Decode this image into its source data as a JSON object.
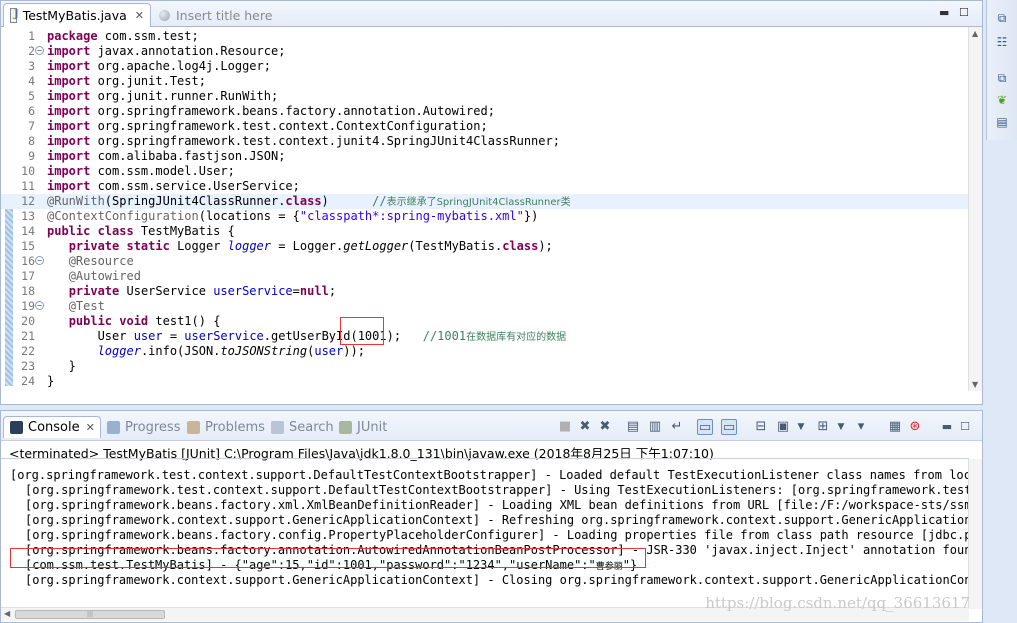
{
  "editor": {
    "tabs": [
      {
        "label": "TestMyBatis.java"
      },
      {
        "label": "Insert title here"
      }
    ],
    "lines": [
      {
        "n": "1",
        "html": "<span class=\"kw\">package</span> com.ssm.test;"
      },
      {
        "n": "2",
        "fold": true,
        "html": "<span class=\"kw\">import</span> javax.annotation.Resource;"
      },
      {
        "n": "3",
        "html": "<span class=\"kw\">import</span> org.apache.log4j.Logger;"
      },
      {
        "n": "4",
        "html": "<span class=\"kw\">import</span> org.junit.Test;"
      },
      {
        "n": "5",
        "html": "<span class=\"kw\">import</span> org.junit.runner.RunWith;"
      },
      {
        "n": "6",
        "html": "<span class=\"kw\">import</span> org.springframework.beans.factory.annotation.Autowired;"
      },
      {
        "n": "7",
        "html": "<span class=\"kw\">import</span> org.springframework.test.context.ContextConfiguration;"
      },
      {
        "n": "8",
        "html": "<span class=\"kw\">import</span> org.springframework.test.context.junit4.SpringJUnit4ClassRunner;"
      },
      {
        "n": "9",
        "html": "<span class=\"kw\">import</span> com.alibaba.fastjson.JSON;"
      },
      {
        "n": "10",
        "html": "<span class=\"kw\">import</span> com.ssm.model.User;"
      },
      {
        "n": "11",
        "html": "<span class=\"kw\">import</span> com.ssm.service.UserService;"
      },
      {
        "n": "12",
        "hl": true,
        "html": "<span class=\"an\">@RunWith</span>(SpringJUnit4ClassRunner.<span class=\"kw\">class</span>)      <span class=\"cm\">//</span><span class=\"cmc\">表示继承了SpringJUnit4ClassRunner类</span>"
      },
      {
        "n": "13",
        "html": "<span class=\"an\">@ContextConfiguration</span>(locations = {<span class=\"st\">\"classpath*:spring-mybatis.xml\"</span>})"
      },
      {
        "n": "14",
        "html": "<span class=\"kw\">public class</span> TestMyBatis {"
      },
      {
        "n": "15",
        "html": "   <span class=\"kw\">private static</span> Logger <span class=\"fi\">logger</span> = Logger.<span class=\"sm\">getLogger</span>(TestMyBatis.<span class=\"kw\">class</span>);"
      },
      {
        "n": "16",
        "fold": true,
        "html": "   <span class=\"an\">@Resource</span>"
      },
      {
        "n": "17",
        "html": "   <span class=\"an\">@Autowired</span>"
      },
      {
        "n": "18",
        "html": "   <span class=\"kw\">private</span> UserService <span class=\"fd\">userService</span>=<span class=\"kw\">null</span>;"
      },
      {
        "n": "19",
        "fold": true,
        "html": "   <span class=\"an\">@Test</span>"
      },
      {
        "n": "20",
        "html": "   <span class=\"kw\">public void</span> test1() {"
      },
      {
        "n": "21",
        "html": "       User <span class=\"fd\">user</span> = <span class=\"fd\">userService</span>.getUserById(1001);   <span class=\"cm\">//1001</span><span class=\"cmc\">在数据库有对应的数据</span>"
      },
      {
        "n": "22",
        "html": "       <span class=\"fi\">logger</span>.info(JSON.<span class=\"sm\">toJSONString</span>(<span class=\"fd\">user</span>));"
      },
      {
        "n": "23",
        "html": "   }"
      },
      {
        "n": "24",
        "html": "}"
      }
    ]
  },
  "console": {
    "tabs": [
      {
        "label": "Console"
      },
      {
        "label": "Progress"
      },
      {
        "label": "Problems"
      },
      {
        "label": "Search"
      },
      {
        "label": "JUnit"
      }
    ],
    "terminated": "<terminated> TestMyBatis [JUnit] C:\\Program Files\\Java\\jdk1.8.0_131\\bin\\javaw.exe (2018年8月25日 下午1:07:10)",
    "output": [
      {
        "indent": 0,
        "text": "[org.springframework.test.context.support.DefaultTestContextBootstrapper] - Loaded default TestExecutionListener class names from locati"
      },
      {
        "indent": 1,
        "text": "[org.springframework.test.context.support.DefaultTestContextBootstrapper] - Using TestExecutionListeners: [org.springframework.test.co"
      },
      {
        "indent": 1,
        "text": "[org.springframework.beans.factory.xml.XmlBeanDefinitionReader] - Loading XML bean definitions from URL [file:/F:/workspace-sts/ssm/ta"
      },
      {
        "indent": 1,
        "text": "[org.springframework.context.support.GenericApplicationContext] - Refreshing org.springframework.context.support.GenericApplicationCon"
      },
      {
        "indent": 1,
        "text": "[org.springframework.beans.factory.config.PropertyPlaceholderConfigurer] - Loading properties file from class path resource [jdbc.prope"
      },
      {
        "indent": 1,
        "text": "[org.springframework.beans.factory.annotation.AutowiredAnnotationBeanPostProcessor] - JSR-330 'javax.inject.Inject' annotation found a"
      },
      {
        "indent": 1,
        "text": "[com.ssm.test.TestMyBatis] - {\"age\":15,\"id\":1001,\"password\":\"1234\",\"userName\":\"",
        "tail": "曹参丽",
        "end": "\"}",
        "highlight": true
      },
      {
        "indent": 1,
        "text": "[org.springframework.context.support.GenericApplicationContext] - Closing org.springframework.context.support.GenericApplicationContext"
      }
    ],
    "watermark": "https://blog.csdn.net/qq_36613617"
  },
  "colors": {
    "keyword": "#7f0055",
    "annotation": "#646464",
    "string": "#2a00ff",
    "field": "#0000c0",
    "comment": "#3f7f5f",
    "highlight_box": "#e33333",
    "panel_border": "#a9b9d3"
  }
}
